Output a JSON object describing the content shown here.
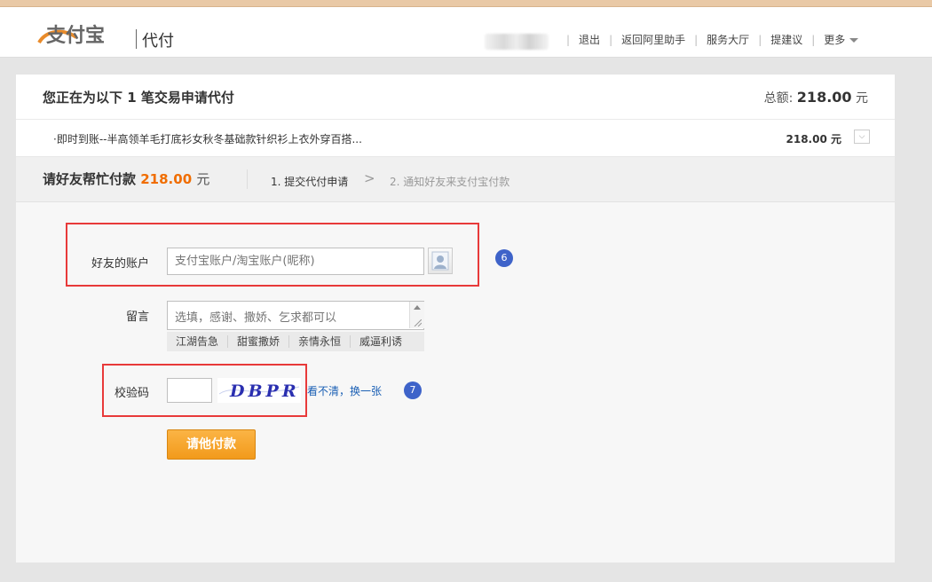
{
  "header": {
    "logo_text": "支付宝",
    "logo_sub": "代付",
    "nav": [
      "退出",
      "返回阿里助手",
      "服务大厅",
      "提建议",
      "更多"
    ]
  },
  "order": {
    "title": "您正在为以下 1 笔交易申请代付",
    "total_label": "总额:",
    "total_amount": "218.00",
    "total_unit": "元",
    "item_name": "·即时到账--半高领羊毛打底衫女秋冬基础款针织衫上衣外穿百搭...",
    "item_price": "218.00 元"
  },
  "steps": {
    "ask_label": "请好友帮忙付款",
    "ask_amount": "218.00",
    "ask_unit": "元",
    "step1": "1. 提交代付申请",
    "arrow": ">",
    "step2": "2. 通知好友来支付宝付款"
  },
  "form": {
    "friend_label": "好友的账户",
    "friend_placeholder": "支付宝账户/淘宝账户(昵称)",
    "message_label": "留言",
    "message_placeholder": "选填，感谢、撒娇、乞求都可以",
    "quick_phrases": [
      "江湖告急",
      "甜蜜撒娇",
      "亲情永恒",
      "威逼利诱"
    ],
    "captcha_label": "校验码",
    "captcha_value": "",
    "captcha_text": "DBPR",
    "refresh_link": "看不清，换一张",
    "submit_label": "请他付款"
  },
  "badges": {
    "friend": "6",
    "captcha": "7"
  },
  "colors": {
    "accent_orange": "#f06d00",
    "button": "#f5a623",
    "highlight": "#e83a3a",
    "badge": "#3e63c9"
  }
}
